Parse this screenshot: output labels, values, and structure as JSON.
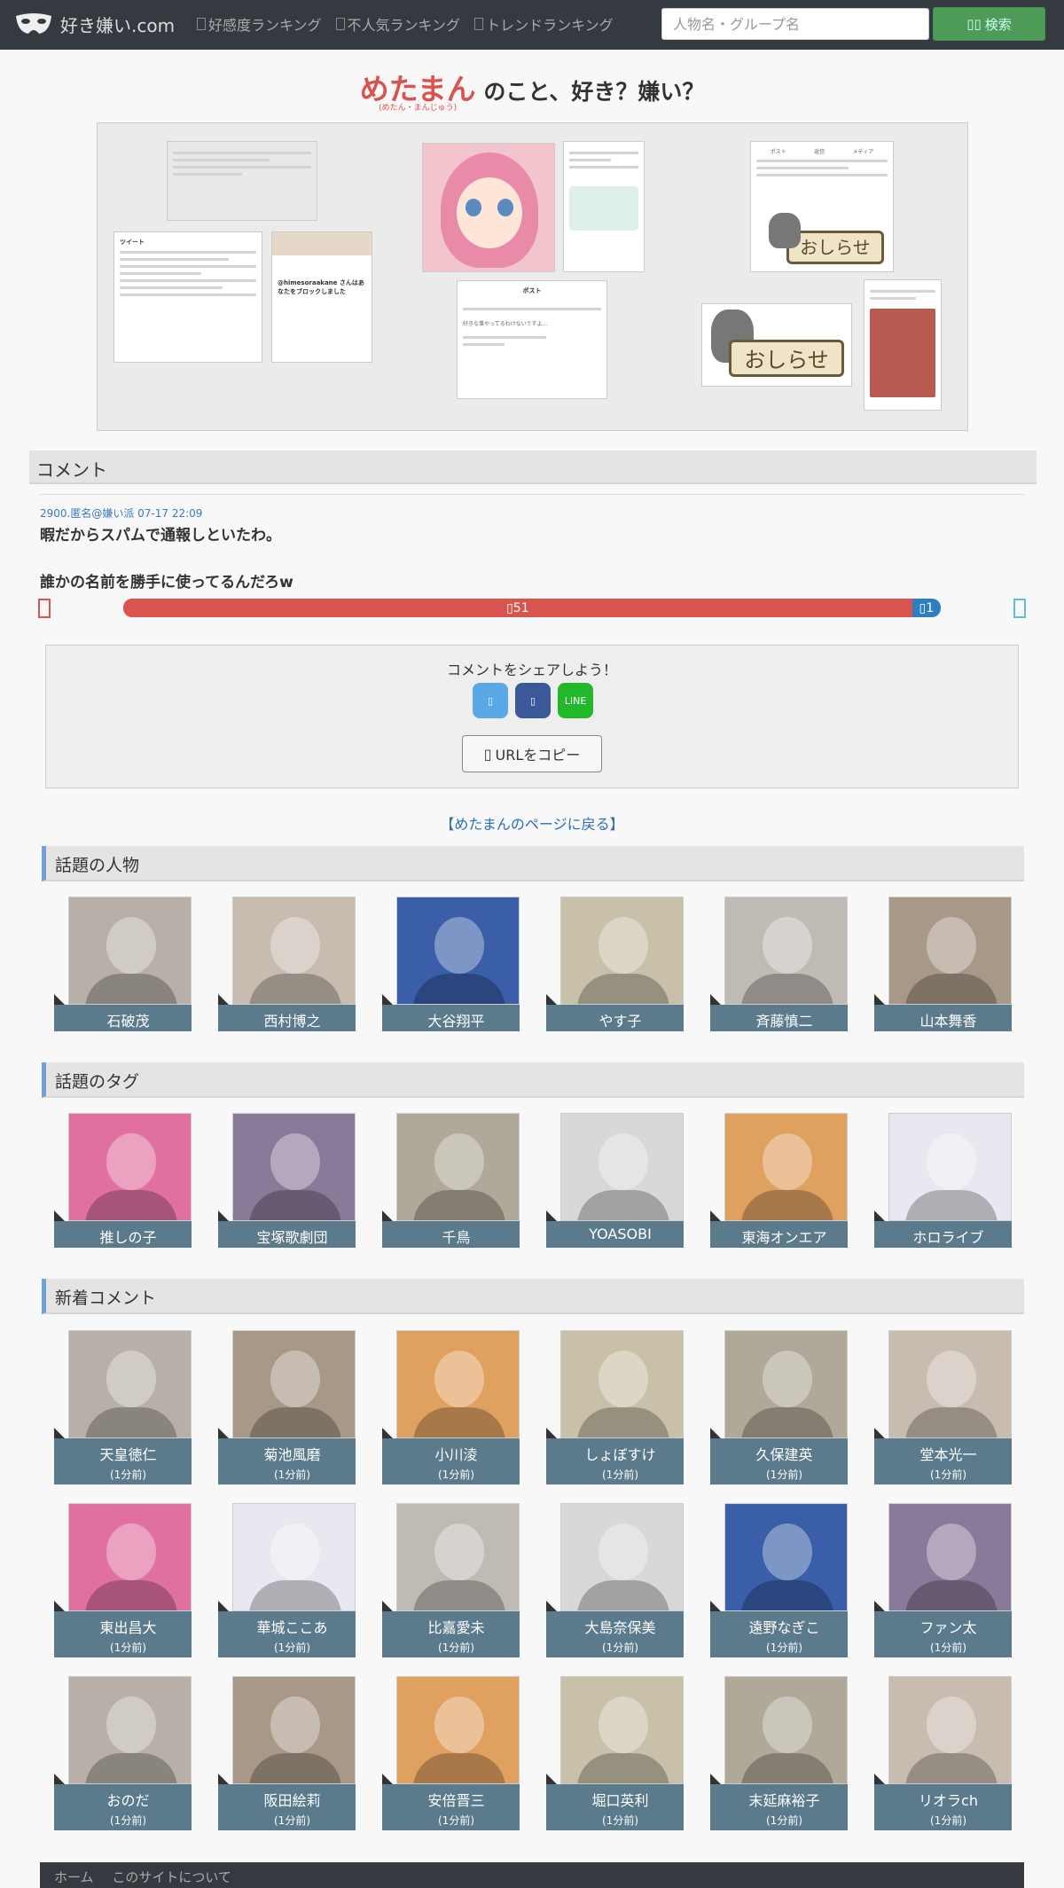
{
  "navbar": {
    "logo_text": "好き嫌い.com",
    "links": [
      {
        "label": "好感度ランキング"
      },
      {
        "label": "不人気ランキング"
      },
      {
        "label": "トレンドランキング"
      }
    ],
    "search_placeholder": "人物名・グループ名",
    "search_button": "検索"
  },
  "title": {
    "name": "めたまん",
    "ruby": "(めたん・まんじゅう)",
    "suffix": "のこと、好き？嫌い？"
  },
  "gallery": {
    "signs": [
      "おしらせ",
      "おしらせ"
    ],
    "tweet_header": "ポスト",
    "tweet_text": "好きな事やってるわけないですよ...",
    "block_text": "@himesoraakane さんはあなたをブロックしました",
    "tabs": [
      "ポスト",
      "返信",
      "メディア"
    ]
  },
  "comment_section": {
    "heading": "コメント",
    "meta": "2900.匿名@嫌い派 07-17 22:09",
    "text": "暇だからスパムで通報しといたわ。",
    "reply": "誰かの名前を勝手に使ってるんだろw",
    "dislike_count": "51",
    "like_count": "1",
    "dislike_fraction": 0.965
  },
  "share": {
    "title": "コメントをシェアしよう！",
    "line_label": "LINE",
    "copy_label": "URLをコピー"
  },
  "back_link": "【めたまんのページに戻る】",
  "trending_people": {
    "heading": "話題の人物",
    "items": [
      "石破茂",
      "西村博之",
      "大谷翔平",
      "やす子",
      "斉藤慎二",
      "山本舞香"
    ]
  },
  "trending_tags": {
    "heading": "話題のタグ",
    "items": [
      "推しの子",
      "宝塚歌劇団",
      "千鳥",
      "YOASOBI",
      "東海オンエア",
      "ホロライブ"
    ]
  },
  "new_comments": {
    "heading": "新着コメント",
    "items": [
      {
        "name": "天皇徳仁",
        "time": "(1分前)"
      },
      {
        "name": "菊池風磨",
        "time": "(1分前)"
      },
      {
        "name": "小川淩",
        "time": "(1分前)"
      },
      {
        "name": "しょぼすけ",
        "time": "(1分前)"
      },
      {
        "name": "久保建英",
        "time": "(1分前)"
      },
      {
        "name": "堂本光一",
        "time": "(1分前)"
      },
      {
        "name": "東出昌大",
        "time": "(1分前)"
      },
      {
        "name": "華城ここあ",
        "time": "(1分前)"
      },
      {
        "name": "比嘉愛未",
        "time": "(1分前)"
      },
      {
        "name": "大島奈保美",
        "time": "(1分前)"
      },
      {
        "name": "遠野なぎこ",
        "time": "(1分前)"
      },
      {
        "name": "ファン太",
        "time": "(1分前)"
      },
      {
        "name": "おのだ",
        "time": "(1分前)"
      },
      {
        "name": "阪田絵莉",
        "time": "(1分前)"
      },
      {
        "name": "安倍晋三",
        "time": "(1分前)"
      },
      {
        "name": "堀口英利",
        "time": "(1分前)"
      },
      {
        "name": "末延麻裕子",
        "time": "(1分前)"
      },
      {
        "name": "リオラch",
        "time": "(1分前)"
      }
    ]
  },
  "footer": {
    "links": [
      "ホーム",
      "このサイトについて"
    ]
  },
  "colors": {
    "navbar": "#343a40",
    "accent_red": "#d9534f",
    "accent_blue": "#2e7fc1",
    "label_bg": "#5b7a8c",
    "search_green": "#4e9a58"
  },
  "icons": [
    "logo-mask-icon",
    "ranking-icon",
    "search-icon",
    "thumbs-down-icon",
    "thumbs-up-icon",
    "twitter-icon",
    "facebook-icon",
    "clipboard-icon"
  ]
}
